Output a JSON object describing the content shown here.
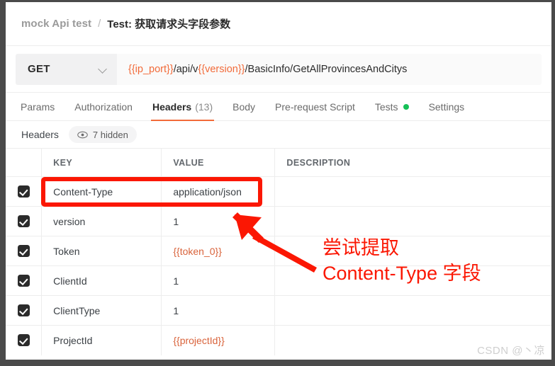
{
  "breadcrumb": {
    "parent": "mock Api test",
    "separator": "/",
    "current": "Test: 获取请求头字段参数"
  },
  "request": {
    "method": "GET",
    "url_parts": [
      {
        "text": "{{ip_port}}",
        "variable": true
      },
      {
        "text": "/api/v",
        "variable": false
      },
      {
        "text": "{{version}}",
        "variable": true
      },
      {
        "text": "/BasicInfo/GetAllProvincesAndCitys",
        "variable": false
      }
    ],
    "url_full": "{{ip_port}}/api/v{{version}}/BasicInfo/GetAllProvincesAndCitys"
  },
  "tabs": [
    {
      "label": "Params",
      "active": false,
      "count": null,
      "dot": false
    },
    {
      "label": "Authorization",
      "active": false,
      "count": null,
      "dot": false
    },
    {
      "label": "Headers",
      "active": true,
      "count": "(13)",
      "dot": false
    },
    {
      "label": "Body",
      "active": false,
      "count": null,
      "dot": false
    },
    {
      "label": "Pre-request Script",
      "active": false,
      "count": null,
      "dot": false
    },
    {
      "label": "Tests",
      "active": false,
      "count": null,
      "dot": true
    },
    {
      "label": "Settings",
      "active": false,
      "count": null,
      "dot": false
    }
  ],
  "headers_section": {
    "title": "Headers",
    "hidden_pill": "7 hidden",
    "eye_icon": "eye-icon"
  },
  "table": {
    "columns": [
      "KEY",
      "VALUE",
      "DESCRIPTION"
    ],
    "rows": [
      {
        "checked": true,
        "key": "Content-Type",
        "value": "application/json",
        "value_is_variable": false,
        "description": "",
        "highlighted": true
      },
      {
        "checked": true,
        "key": "version",
        "value": "1",
        "value_is_variable": false,
        "description": "",
        "highlighted": false
      },
      {
        "checked": true,
        "key": "Token",
        "value": "{{token_0}}",
        "value_is_variable": true,
        "description": "",
        "highlighted": false
      },
      {
        "checked": true,
        "key": "ClientId",
        "value": "1",
        "value_is_variable": false,
        "description": "",
        "highlighted": false
      },
      {
        "checked": true,
        "key": "ClientType",
        "value": "1",
        "value_is_variable": false,
        "description": "",
        "highlighted": false
      },
      {
        "checked": true,
        "key": "ProjectId",
        "value": "{{projectId}}",
        "value_is_variable": true,
        "description": "",
        "highlighted": false
      }
    ]
  },
  "annotation": {
    "line1": "尝试提取",
    "line2": "Content-Type 字段",
    "color": "#fb1703",
    "arrow": "arrow-pointing-up-left"
  },
  "watermark": "CSDN @丶凉",
  "colors": {
    "accent": "#f26b3a",
    "variable": "#d9633b",
    "annotation_red": "#fb1703",
    "tests_dot_green": "#16c057",
    "checkbox": "#2b2b2b"
  }
}
